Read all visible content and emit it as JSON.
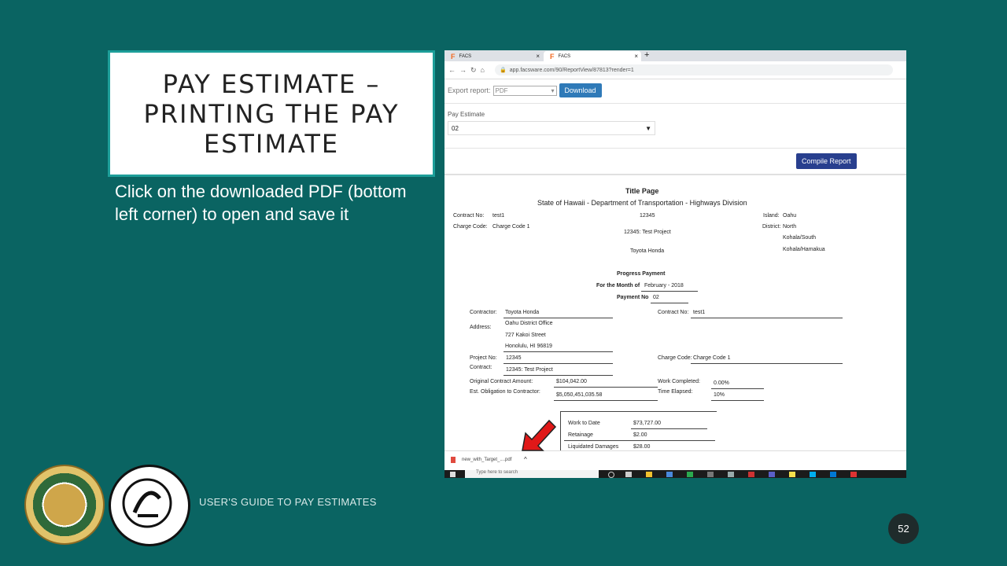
{
  "slide": {
    "title": "PAY ESTIMATE –\nPRINTING THE PAY\nESTIMATE",
    "instruction": "Click on the downloaded PDF (bottom left corner) to open and save it",
    "footer": "USER'S GUIDE TO PAY ESTIMATES",
    "page_number": "52"
  },
  "browser": {
    "tabs": [
      {
        "label": "FACS",
        "close": "×"
      },
      {
        "label": "FACS",
        "close": "×"
      }
    ],
    "new_tab": "+",
    "url": "app.facsware.com/90/ReportView/87813?render=1"
  },
  "report_controls": {
    "export_label": "Export report:",
    "export_value": "PDF",
    "download_label": "Download",
    "pay_estimate_label": "Pay Estimate",
    "pay_estimate_value": "02",
    "compile_label": "Compile Report"
  },
  "document": {
    "title": "Title Page",
    "subtitle": "State of Hawaii - Department of Transportation - Highways Division",
    "header": {
      "contract_no_label": "Contract No:",
      "contract_no": "test1",
      "charge_code_label": "Charge Code:",
      "charge_code": "Charge Code 1",
      "project_number": "12345",
      "project_name": "12345: Test Project",
      "contractor": "Toyota Honda",
      "island_label": "Island:",
      "island": "Oahu",
      "district_label": "District:",
      "district_1": "North",
      "district_2": "Kohala/South",
      "district_3": "Kohala/Hamakua"
    },
    "progress": {
      "heading": "Progress Payment",
      "month_label": "For the Month of",
      "month": "February - 2018",
      "payment_label": "Payment No",
      "payment_no": "02"
    },
    "details": {
      "contractor_label": "Contractor:",
      "contractor": "Toyota Honda",
      "address_label": "Address:",
      "address_1": "Oahu District Office",
      "address_2": "727 Kakoi Street",
      "address_3": "Honolulu, HI 96819",
      "project_no_label": "Project No:",
      "project_no": "12345",
      "contract_label": "Contract:",
      "contract": "12345: Test Project",
      "contract_no_label": "Contract No:",
      "contract_no": "test1",
      "charge_code_label": "Charge Code:",
      "charge_code": "Charge Code 1",
      "orig_amount_label": "Original Contract Amount:",
      "orig_amount": "$104,042.00",
      "est_obligation_label": "Est. Obligation to Contractor:",
      "est_obligation": "$5,050,451,035.58",
      "work_completed_label": "Work Completed:",
      "work_completed": "0.00%",
      "time_elapsed_label": "Time Elapsed:",
      "time_elapsed": "10%"
    },
    "summary": [
      {
        "label": "Work to Date",
        "value": "$73,727.00"
      },
      {
        "label": "Retainage",
        "value": "$2.00"
      },
      {
        "label": "Liquidated Damages",
        "value": "$28.00"
      }
    ]
  },
  "download_bar": {
    "file": "new_with_Target_....pdf",
    "caret": "^"
  },
  "taskbar": {
    "search_placeholder": "Type here to search"
  }
}
